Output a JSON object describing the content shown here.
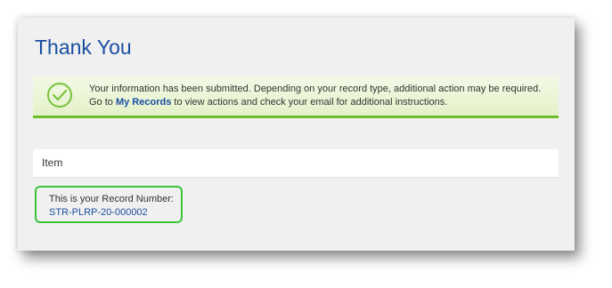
{
  "page": {
    "title": "Thank You"
  },
  "banner": {
    "icon": "checkmark-circle-icon",
    "text_before": "Your information has been submitted. Depending on your record type, additional action may be required. Go to ",
    "link_text": "My Records",
    "text_after": " to view actions and check your email for additional instructions.",
    "accent_color": "#6bbf2a"
  },
  "item": {
    "label": "Item"
  },
  "record": {
    "label": "This is your Record Number:",
    "number": "STR-PLRP-20-000002",
    "highlight_color": "#3bc23b"
  },
  "colors": {
    "title": "#1a4fa0",
    "link": "#1a4fa0"
  }
}
